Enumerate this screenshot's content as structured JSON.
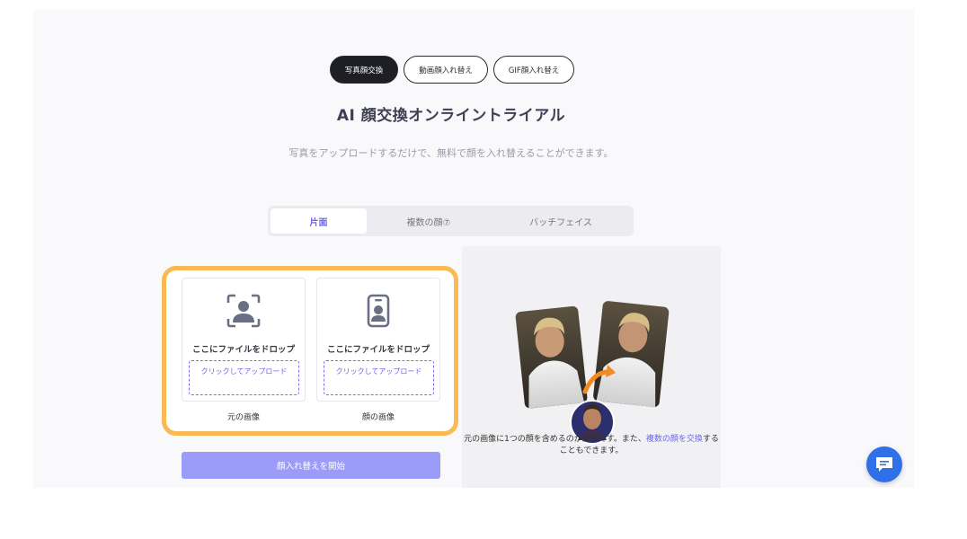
{
  "mode_tabs": [
    {
      "label": "写真顔交換",
      "active": true
    },
    {
      "label": "動画顔入れ替え",
      "active": false
    },
    {
      "label": "GIF顔入れ替え",
      "active": false
    }
  ],
  "title": "AI 顔交換オンライントライアル",
  "subtitle": "写真をアップロードするだけで、無料で顔を入れ替えることができます。",
  "face_tabs": [
    {
      "label": "片面",
      "active": true
    },
    {
      "label": "複数の顔⑦",
      "active": false
    },
    {
      "label": "バッチフェイス",
      "active": false
    }
  ],
  "upload": {
    "source": {
      "drop_text": "ここにファイルをドロップ",
      "upload_link": "クリックしてアップロード",
      "caption": "元の画像",
      "icon": "person-frame-icon"
    },
    "face": {
      "drop_text": "ここにファイルをドロップ",
      "upload_link": "クリックしてアップロード",
      "caption": "顔の画像",
      "icon": "id-card-icon"
    }
  },
  "start_button": "顔入れ替えを開始",
  "preview": {
    "note_before": "元の画像に1つの顔を含めるのが最善です。また、",
    "note_link": "複数の顔を交換",
    "note_after": "することもできます。"
  },
  "colors": {
    "accent": "#6c63f0",
    "highlight_frame": "#fbb953",
    "start_button": "#9b9cf9",
    "chat_button": "#2f6fe8"
  },
  "chat_icon": "chat-bubble-icon"
}
